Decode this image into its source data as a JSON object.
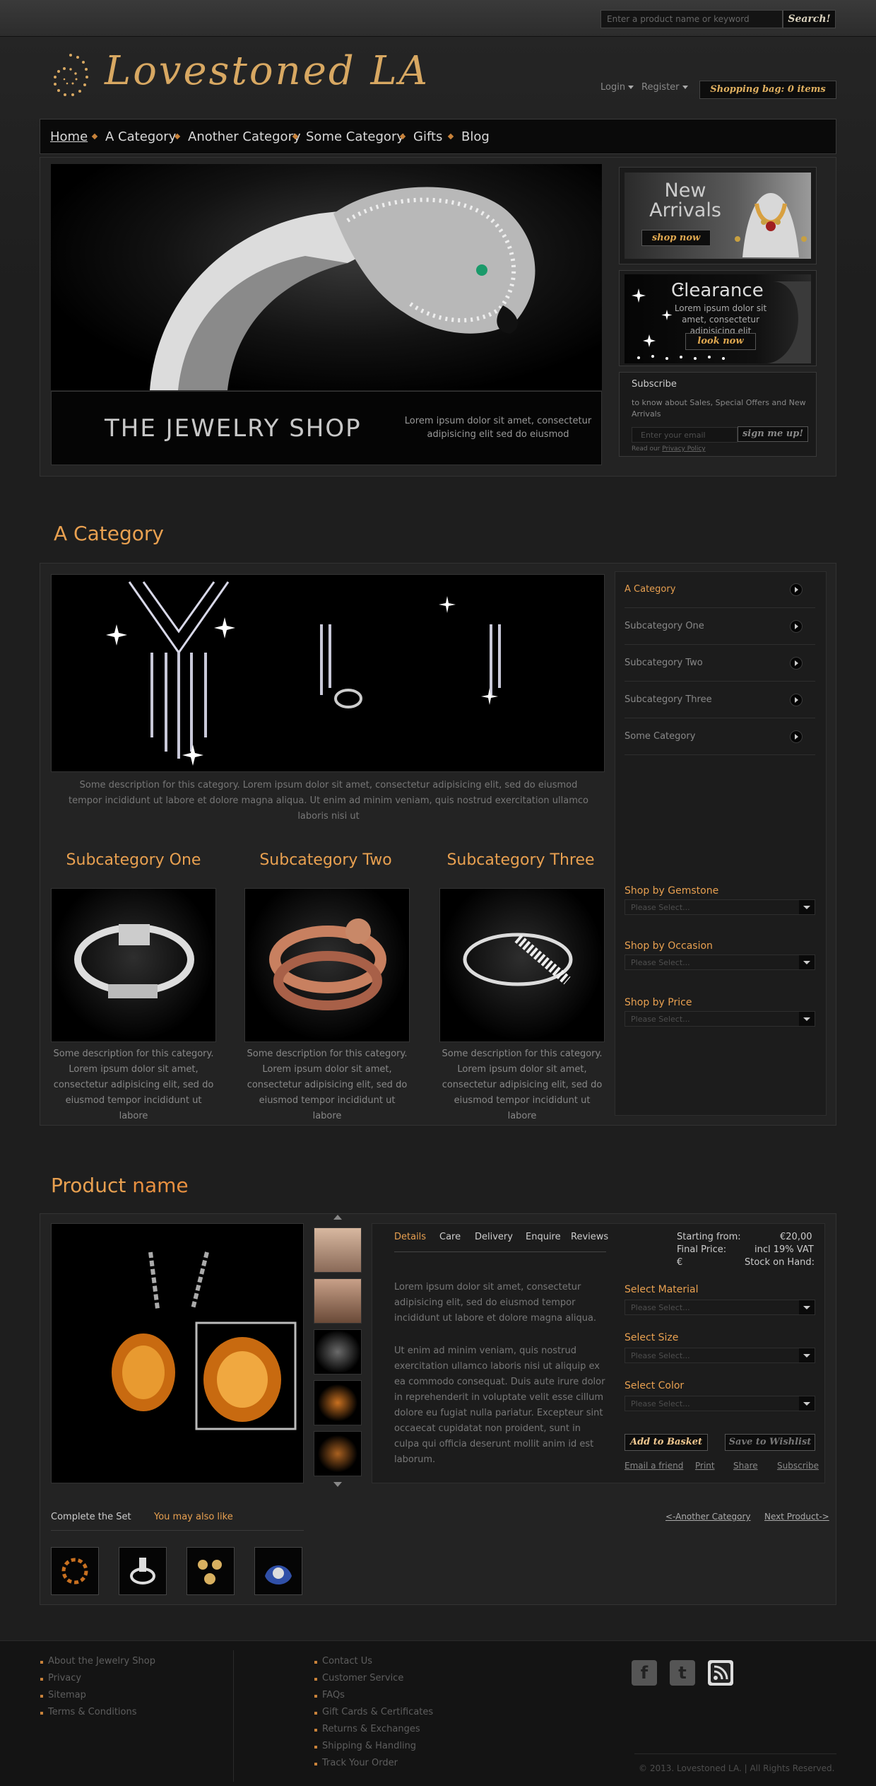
{
  "header": {
    "search_placeholder": "Enter a product name or keyword",
    "search_button": "Search!",
    "logo": "Lovestoned LA",
    "login": "Login",
    "register": "Register",
    "shopping_bag": "Shopping bag: 0 items"
  },
  "nav": [
    "Home",
    "A Category",
    "Another Category",
    "Some Category",
    "Gifts",
    "Blog"
  ],
  "hero": {
    "title": "THE JEWELRY SHOP",
    "description": "Lorem ipsum dolor sit amet, consectetur adipisicing elit sed do eiusmod"
  },
  "promo": {
    "new_line1": "New",
    "new_line2": "Arrivals",
    "shop_now": "shop now",
    "clearance_title": "Clearance",
    "clearance_text": "Lorem ipsum dolor sit amet, consectetur adipisicing elit",
    "look_now": "look now"
  },
  "subscribe": {
    "title": "Subscribe",
    "text": "to know about Sales, Special Offers and New Arrivals",
    "placeholder": "Enter your email",
    "button": "sign me up!",
    "privacy_prefix": "Read our",
    "privacy_link": "Privacy Policy"
  },
  "category": {
    "title": "A Category",
    "description": "Some description for this category. Lorem ipsum dolor sit amet, consectetur adipisicing elit, sed do eiusmod tempor incididunt ut labore et dolore magna aliqua. Ut enim ad minim veniam, quis nostrud exercitation ullamco laboris nisi ut",
    "menu": [
      "A Category",
      "Subcategory One",
      "Subcategory Two",
      "Subcategory Three",
      "Some Category"
    ],
    "filters": [
      {
        "label": "Shop by Gemstone",
        "value": "Please Select..."
      },
      {
        "label": "Shop by Occasion",
        "value": "Please Select..."
      },
      {
        "label": "Shop by Price",
        "value": "Please Select..."
      }
    ],
    "subcategories": [
      {
        "title": "Subcategory One",
        "desc": "Some description for this category. Lorem ipsum dolor sit amet, consectetur adipisicing elit, sed do eiusmod tempor incididunt ut labore"
      },
      {
        "title": "Subcategory Two",
        "desc": "Some description for this category. Lorem ipsum dolor sit amet, consectetur adipisicing elit, sed do eiusmod tempor incididunt ut labore"
      },
      {
        "title": "Subcategory Three",
        "desc": "Some description for this category. Lorem ipsum dolor sit amet, consectetur adipisicing elit, sed do eiusmod tempor incididunt ut labore"
      }
    ]
  },
  "product": {
    "title_word1": "Product",
    "title_word2": "name",
    "tabs": [
      "Details",
      "Care",
      "Delivery",
      "Enquire",
      "Reviews"
    ],
    "para1": "Lorem ipsum dolor sit amet, consectetur adipisicing elit, sed do eiusmod tempor incididunt ut labore et dolore magna aliqua.",
    "para2": "Ut enim ad minim veniam, quis nostrud exercitation ullamco laboris nisi ut aliquip ex ea commodo consequat. Duis aute irure dolor in reprehenderit in voluptate velit esse cillum dolore eu fugiat nulla pariatur. Excepteur sint occaecat cupidatat non proident, sunt in culpa qui officia deserunt mollit anim id est laborum.",
    "starting_label": "Starting from:",
    "starting_value": "€20,00",
    "final_label": "Final Price:",
    "final_value": "incl 19% VAT",
    "currency": "€",
    "stock": "Stock on Hand:",
    "options": [
      {
        "label": "Select Material",
        "value": "Please Select..."
      },
      {
        "label": "Select Size",
        "value": "Please Select..."
      },
      {
        "label": "Select Color",
        "value": "Please Select..."
      }
    ],
    "add_to_basket": "Add to Basket",
    "save_to_wishlist": "Save to Wishlist",
    "links": [
      "Email a friend",
      "Print",
      "Share",
      "Subscribe"
    ],
    "complete_set": "Complete the Set",
    "you_may_like": "You may also like",
    "prev": "<-Another Category",
    "next": "Next Product->"
  },
  "footer": {
    "col1": [
      "About the Jewelry Shop",
      "Privacy",
      "Sitemap",
      "Terms & Conditions"
    ],
    "col2": [
      "Contact Us",
      "Customer Service",
      "FAQs",
      "Gift Cards & Certificates",
      "Returns & Exchanges",
      "Shipping & Handling",
      "Track Your Order"
    ],
    "social": [
      "facebook-icon",
      "tumblr-icon",
      "rss-icon"
    ],
    "copyright": "© 2013. Lovestoned LA. | All Rights Reserved."
  },
  "colors": {
    "accent": "#e8a050",
    "background": "#1e1e1e",
    "panel": "#232323"
  }
}
